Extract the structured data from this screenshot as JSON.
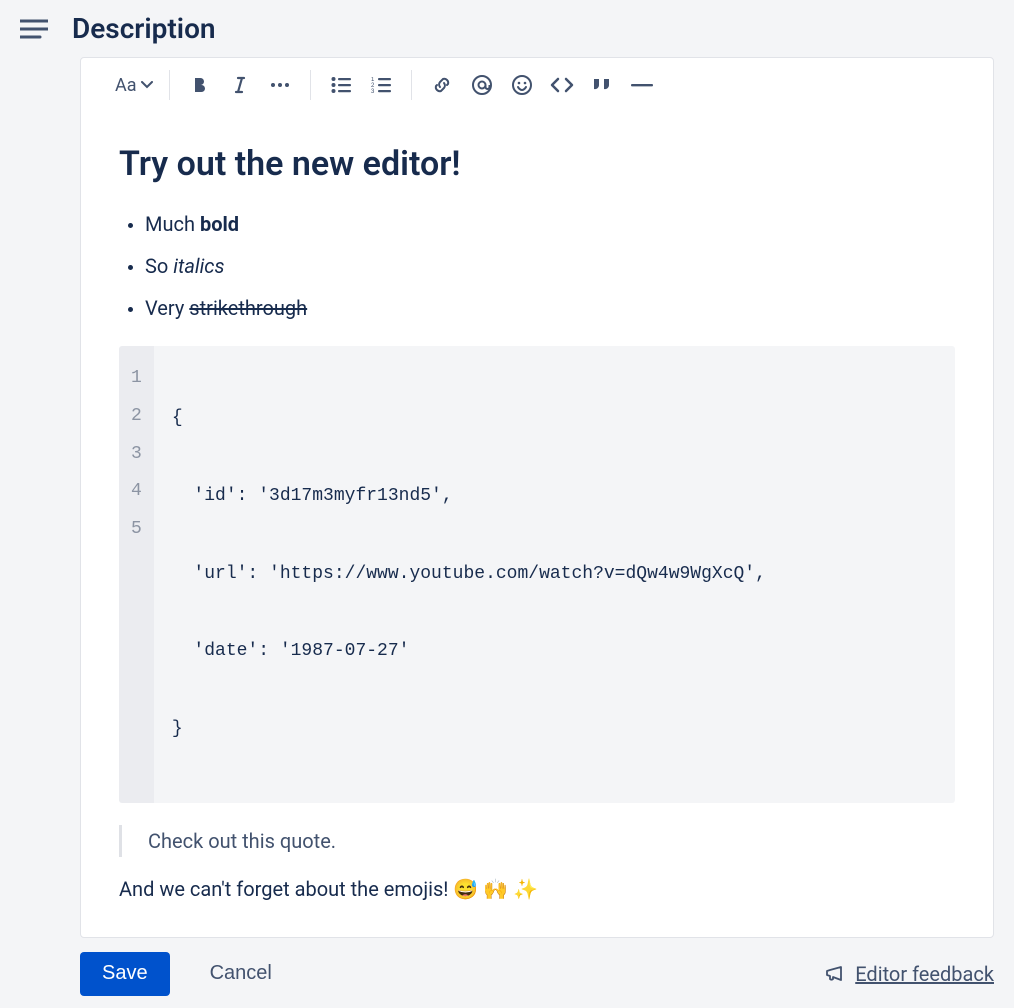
{
  "header": {
    "title": "Description"
  },
  "toolbar": {
    "text_style_label": "Aa"
  },
  "content": {
    "heading": "Try out the new editor!",
    "bullets": {
      "b1_prefix": "Much ",
      "b1_bold": "bold",
      "b2_prefix": "So ",
      "b2_italic": "italics",
      "b3_prefix": "Very ",
      "b3_strike": "strikethrough"
    },
    "code": {
      "line_numbers": [
        "1",
        "2",
        "3",
        "4",
        "5"
      ],
      "lines": [
        "{",
        "  'id': '3d17m3myfr13nd5',",
        "  'url': 'https://www.youtube.com/watch?v=dQw4w9WgXcQ',",
        "  'date': '1987-07-27'",
        "}"
      ]
    },
    "quote": "Check out this quote.",
    "paragraph_text": "And we can't forget about the emojis! ",
    "emoji1": "😅",
    "emoji2": "🙌",
    "emoji3": "✨"
  },
  "actions": {
    "save": "Save",
    "cancel": "Cancel",
    "feedback": "Editor feedback"
  }
}
